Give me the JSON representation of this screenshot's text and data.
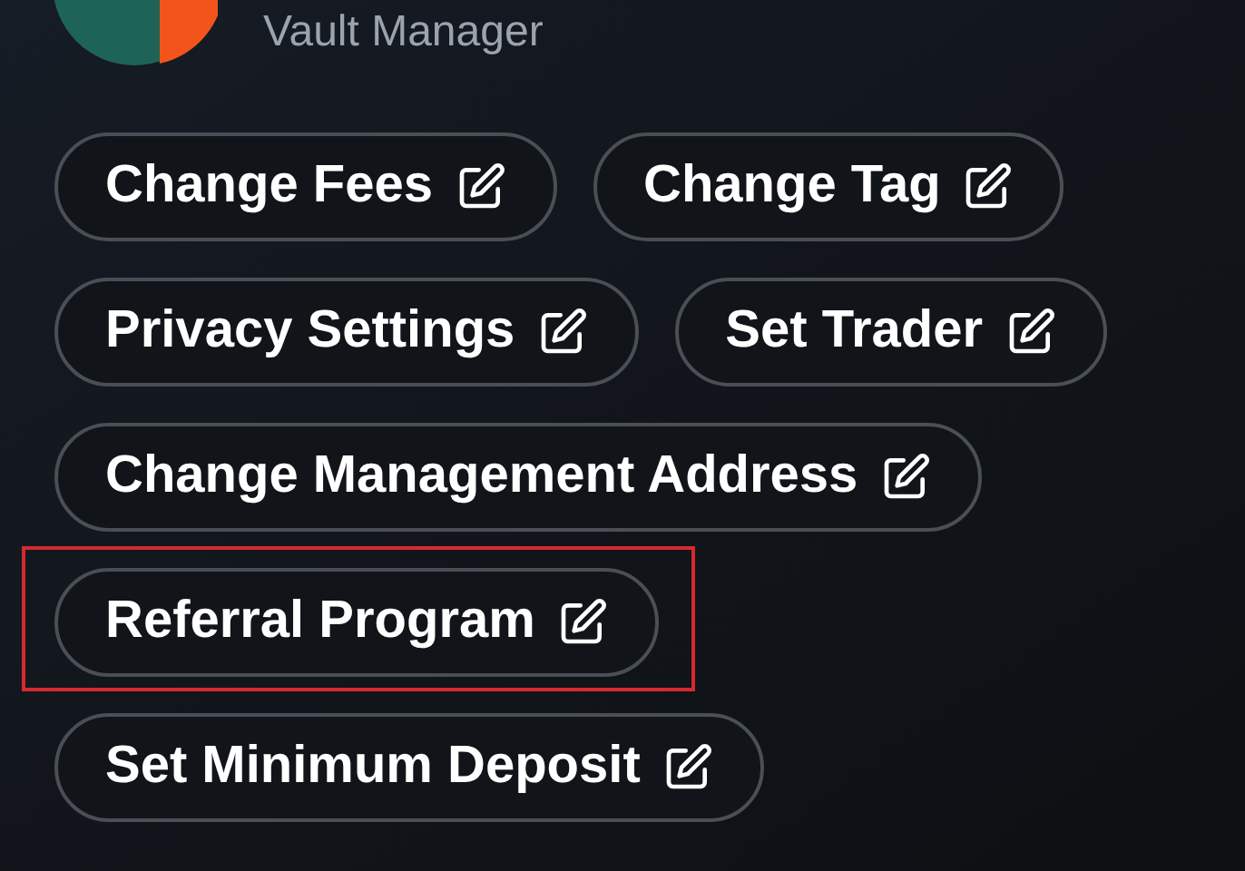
{
  "header": {
    "subtitle": "Vault Manager"
  },
  "rows": [
    {
      "highlighted": false,
      "buttons": [
        "Change Fees",
        "Change Tag"
      ]
    },
    {
      "highlighted": false,
      "buttons": [
        "Privacy Settings",
        "Set Trader"
      ]
    },
    {
      "highlighted": false,
      "buttons": [
        "Change Management Address"
      ]
    },
    {
      "highlighted": true,
      "buttons": [
        "Referral Program"
      ]
    },
    {
      "highlighted": false,
      "buttons": [
        "Set Minimum Deposit"
      ]
    }
  ]
}
